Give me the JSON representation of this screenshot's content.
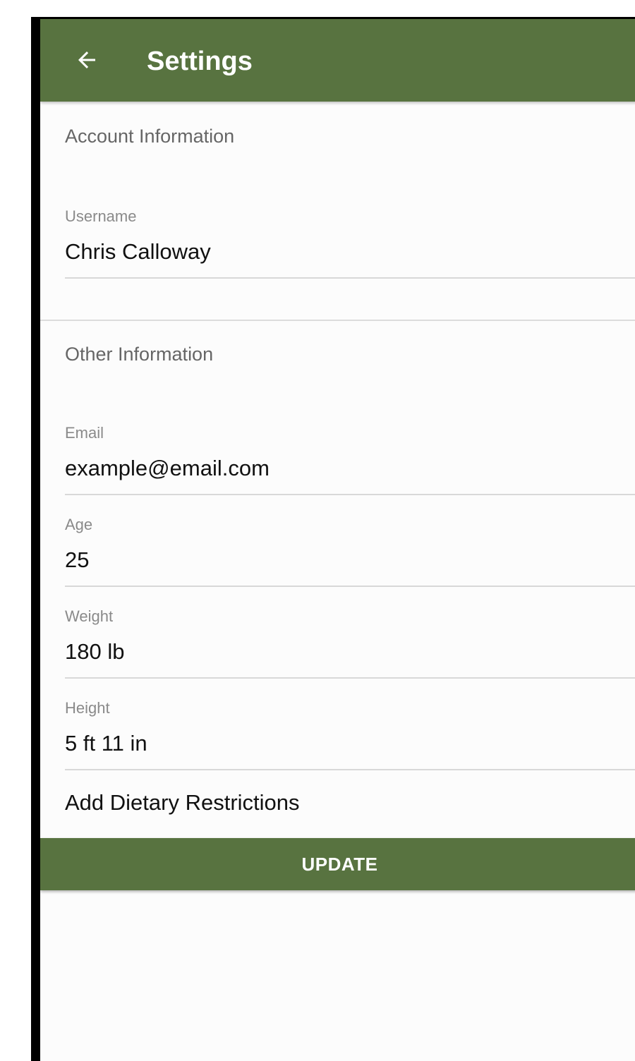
{
  "app_bar": {
    "back_icon": "arrow-left-icon",
    "title": "Settings",
    "color": "#587340"
  },
  "account_section": {
    "header": "Account Information",
    "username": {
      "label": "Username",
      "value": "Chris Calloway"
    }
  },
  "other_section": {
    "header": "Other Information",
    "email": {
      "label": "Email",
      "value": "example@email.com"
    },
    "age": {
      "label": "Age",
      "value": "25"
    },
    "weight": {
      "label": "Weight",
      "value": "180 lb"
    },
    "height": {
      "label": "Height",
      "value": "5 ft 11 in"
    }
  },
  "dietary": {
    "label": "Add Dietary Restrictions",
    "icon": "chevron-right-icon"
  },
  "update_button": {
    "label": "UPDATE"
  }
}
